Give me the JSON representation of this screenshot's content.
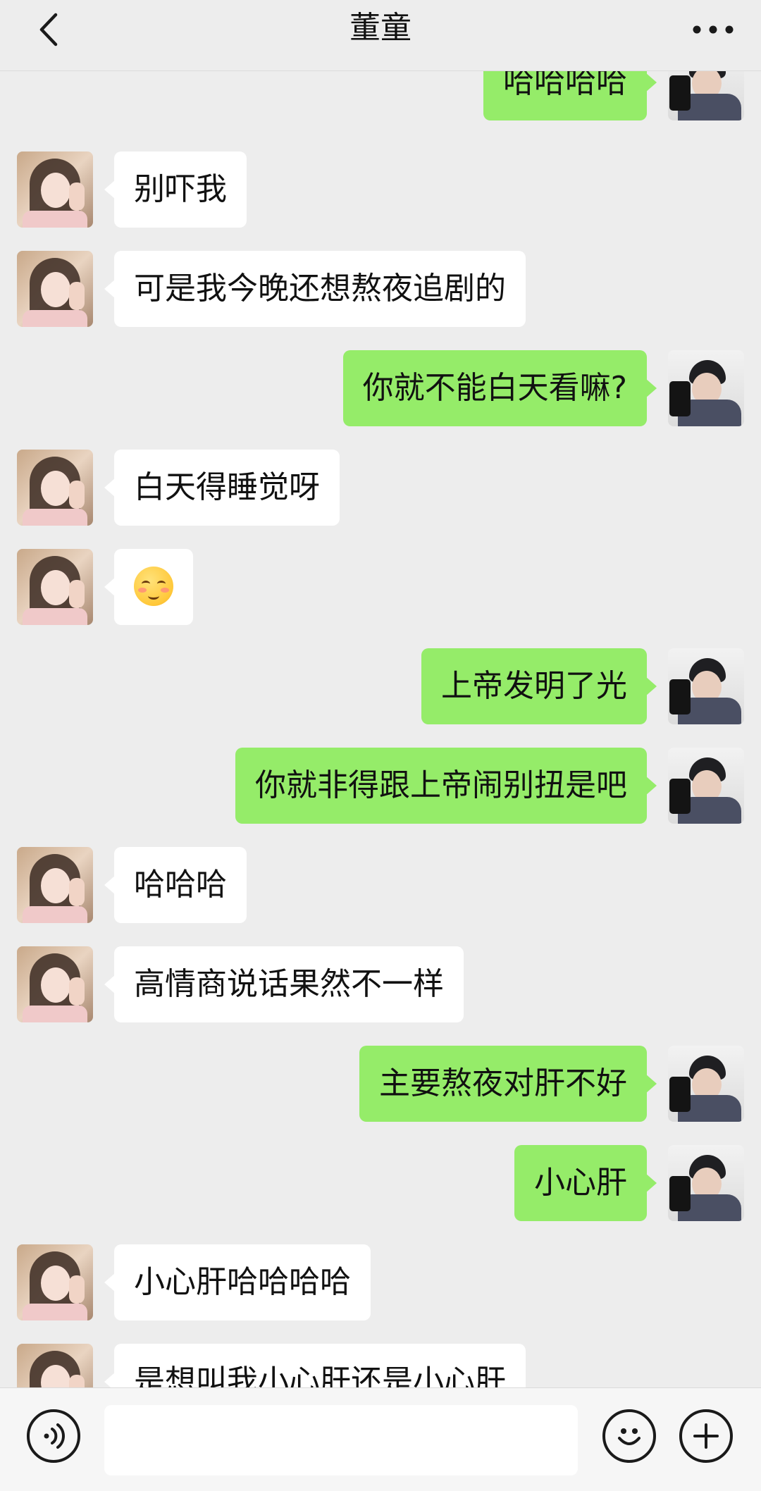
{
  "header": {
    "title": "董童"
  },
  "icons": {
    "back": "chevron-left-icon",
    "more": "more-dots-icon",
    "voice": "voice-icon",
    "emoji": "emoji-icon",
    "plus": "plus-icon"
  },
  "colors": {
    "background": "#ededed",
    "sent_bubble": "#95ec69",
    "received_bubble": "#ffffff"
  },
  "messages": [
    {
      "side": "right",
      "text": "哈哈哈哈"
    },
    {
      "side": "left",
      "text": "别吓我"
    },
    {
      "side": "left",
      "text": "可是我今晚还想熬夜追剧的"
    },
    {
      "side": "right",
      "text": "你就不能白天看嘛?"
    },
    {
      "side": "left",
      "text": "白天得睡觉呀"
    },
    {
      "side": "left",
      "text": "",
      "emoji": "smiling-face-with-blush-emoji"
    },
    {
      "side": "right",
      "text": "上帝发明了光"
    },
    {
      "side": "right",
      "text": "你就非得跟上帝闹别扭是吧"
    },
    {
      "side": "left",
      "text": "哈哈哈"
    },
    {
      "side": "left",
      "text": "高情商说话果然不一样"
    },
    {
      "side": "right",
      "text": "主要熬夜对肝不好"
    },
    {
      "side": "right",
      "text": "小心肝"
    },
    {
      "side": "left",
      "text": "小心肝哈哈哈哈"
    },
    {
      "side": "left",
      "text": "是想叫我小心肝还是小心肝"
    }
  ],
  "input": {
    "value": "",
    "placeholder": ""
  }
}
